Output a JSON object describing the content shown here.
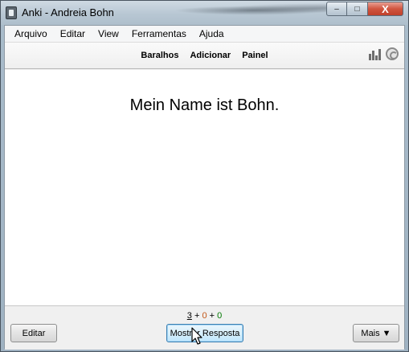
{
  "window": {
    "title": "Anki - Andreia Bohn",
    "controls": {
      "minimize": "–",
      "maximize": "□",
      "close": "X"
    }
  },
  "menu": {
    "items": [
      "Arquivo",
      "Editar",
      "View",
      "Ferramentas",
      "Ajuda"
    ]
  },
  "toolbar": {
    "links": [
      "Baralhos",
      "Adicionar",
      "Painel"
    ],
    "right_icons": [
      "stats-icon",
      "sync-icon"
    ]
  },
  "card": {
    "question": "Mein Name ist Bohn."
  },
  "counts": {
    "new": "3",
    "learn": "0",
    "review": "0",
    "sep": "+"
  },
  "buttons": {
    "edit": "Editar",
    "show_answer": "Mostrar Resposta",
    "more": "Mais ▼"
  },
  "colors": {
    "learn": "#c35617",
    "review": "#007700",
    "focused_button_border": "#3c7fb1"
  }
}
